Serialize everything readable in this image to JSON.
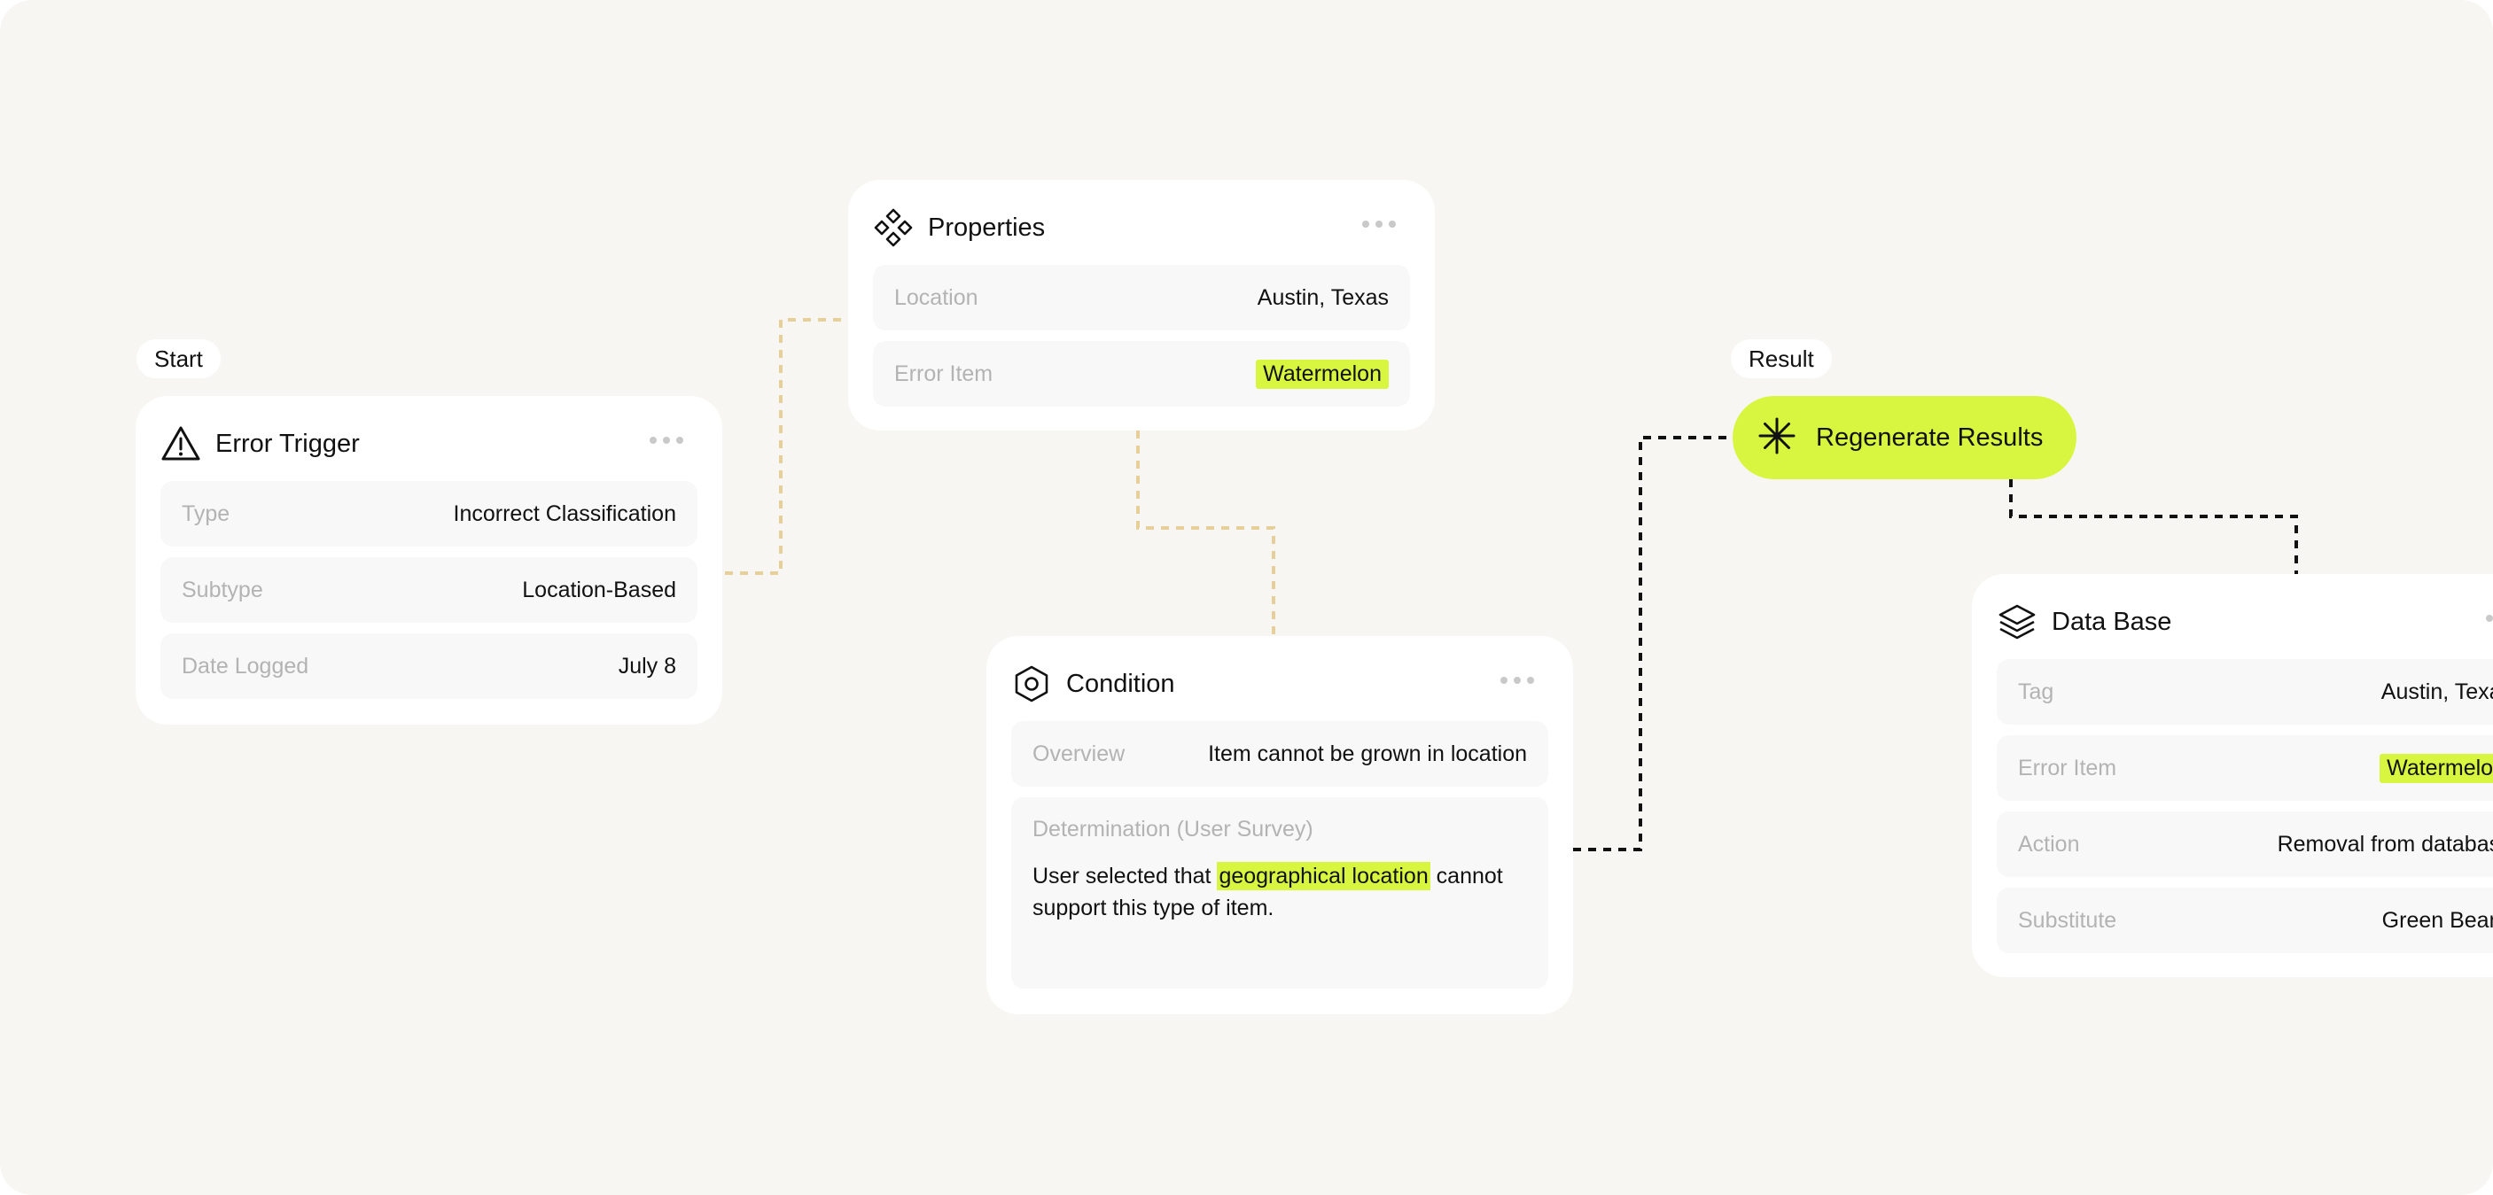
{
  "labels": {
    "start": "Start",
    "result": "Result"
  },
  "error_trigger": {
    "title": "Error Trigger",
    "icon": "warning-triangle-icon",
    "rows": [
      {
        "key": "Type",
        "value": "Incorrect Classification"
      },
      {
        "key": "Subtype",
        "value": "Location-Based"
      },
      {
        "key": "Date Logged",
        "value": "July 8"
      }
    ]
  },
  "properties": {
    "title": "Properties",
    "icon": "diamond-cluster-icon",
    "rows": [
      {
        "key": "Location",
        "value": "Austin, Texas"
      },
      {
        "key": "Error Item",
        "value": "Watermelon"
      }
    ]
  },
  "condition": {
    "title": "Condition",
    "icon": "hexagon-nut-icon",
    "overview": {
      "key": "Overview",
      "value": "Item cannot be grown in location"
    },
    "determination": {
      "key": "Determination (User Survey)",
      "text_before": "User selected that ",
      "highlight": "geographical location",
      "text_after": " cannot support this type of item."
    }
  },
  "result_action": {
    "label": "Regenerate Results",
    "icon": "asterisk-icon"
  },
  "database": {
    "title": "Data Base",
    "icon": "layers-icon",
    "rows": [
      {
        "key": "Tag",
        "value": "Austin, Texas"
      },
      {
        "key": "Error Item",
        "value": "Watermelon"
      },
      {
        "key": "Action",
        "value": "Removal from database"
      },
      {
        "key": "Substitute",
        "value": "Green Beans"
      }
    ]
  },
  "colors": {
    "accent": "#d8f63f",
    "background": "#f7f6f2",
    "connector_light": "#e6cf98",
    "connector_dark": "#111111"
  }
}
